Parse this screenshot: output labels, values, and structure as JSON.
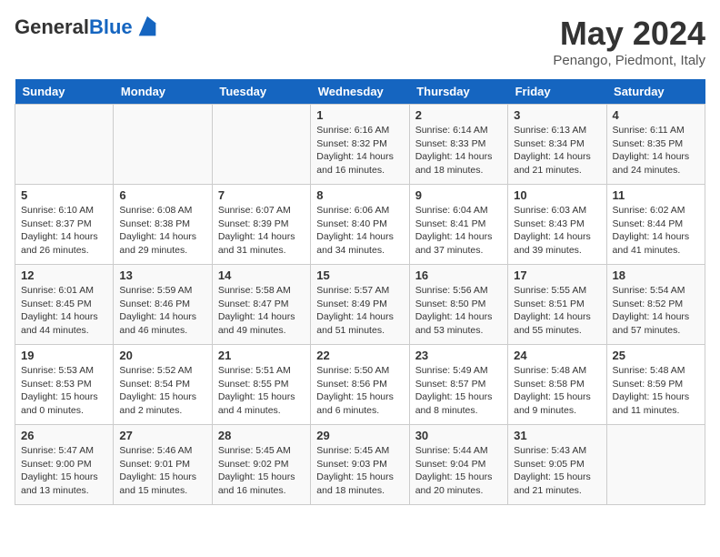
{
  "logo": {
    "general": "General",
    "blue": "Blue"
  },
  "title": "May 2024",
  "subtitle": "Penango, Piedmont, Italy",
  "days_of_week": [
    "Sunday",
    "Monday",
    "Tuesday",
    "Wednesday",
    "Thursday",
    "Friday",
    "Saturday"
  ],
  "weeks": [
    [
      {
        "day": "",
        "info": ""
      },
      {
        "day": "",
        "info": ""
      },
      {
        "day": "",
        "info": ""
      },
      {
        "day": "1",
        "info": "Sunrise: 6:16 AM\nSunset: 8:32 PM\nDaylight: 14 hours and 16 minutes."
      },
      {
        "day": "2",
        "info": "Sunrise: 6:14 AM\nSunset: 8:33 PM\nDaylight: 14 hours and 18 minutes."
      },
      {
        "day": "3",
        "info": "Sunrise: 6:13 AM\nSunset: 8:34 PM\nDaylight: 14 hours and 21 minutes."
      },
      {
        "day": "4",
        "info": "Sunrise: 6:11 AM\nSunset: 8:35 PM\nDaylight: 14 hours and 24 minutes."
      }
    ],
    [
      {
        "day": "5",
        "info": "Sunrise: 6:10 AM\nSunset: 8:37 PM\nDaylight: 14 hours and 26 minutes."
      },
      {
        "day": "6",
        "info": "Sunrise: 6:08 AM\nSunset: 8:38 PM\nDaylight: 14 hours and 29 minutes."
      },
      {
        "day": "7",
        "info": "Sunrise: 6:07 AM\nSunset: 8:39 PM\nDaylight: 14 hours and 31 minutes."
      },
      {
        "day": "8",
        "info": "Sunrise: 6:06 AM\nSunset: 8:40 PM\nDaylight: 14 hours and 34 minutes."
      },
      {
        "day": "9",
        "info": "Sunrise: 6:04 AM\nSunset: 8:41 PM\nDaylight: 14 hours and 37 minutes."
      },
      {
        "day": "10",
        "info": "Sunrise: 6:03 AM\nSunset: 8:43 PM\nDaylight: 14 hours and 39 minutes."
      },
      {
        "day": "11",
        "info": "Sunrise: 6:02 AM\nSunset: 8:44 PM\nDaylight: 14 hours and 41 minutes."
      }
    ],
    [
      {
        "day": "12",
        "info": "Sunrise: 6:01 AM\nSunset: 8:45 PM\nDaylight: 14 hours and 44 minutes."
      },
      {
        "day": "13",
        "info": "Sunrise: 5:59 AM\nSunset: 8:46 PM\nDaylight: 14 hours and 46 minutes."
      },
      {
        "day": "14",
        "info": "Sunrise: 5:58 AM\nSunset: 8:47 PM\nDaylight: 14 hours and 49 minutes."
      },
      {
        "day": "15",
        "info": "Sunrise: 5:57 AM\nSunset: 8:49 PM\nDaylight: 14 hours and 51 minutes."
      },
      {
        "day": "16",
        "info": "Sunrise: 5:56 AM\nSunset: 8:50 PM\nDaylight: 14 hours and 53 minutes."
      },
      {
        "day": "17",
        "info": "Sunrise: 5:55 AM\nSunset: 8:51 PM\nDaylight: 14 hours and 55 minutes."
      },
      {
        "day": "18",
        "info": "Sunrise: 5:54 AM\nSunset: 8:52 PM\nDaylight: 14 hours and 57 minutes."
      }
    ],
    [
      {
        "day": "19",
        "info": "Sunrise: 5:53 AM\nSunset: 8:53 PM\nDaylight: 15 hours and 0 minutes."
      },
      {
        "day": "20",
        "info": "Sunrise: 5:52 AM\nSunset: 8:54 PM\nDaylight: 15 hours and 2 minutes."
      },
      {
        "day": "21",
        "info": "Sunrise: 5:51 AM\nSunset: 8:55 PM\nDaylight: 15 hours and 4 minutes."
      },
      {
        "day": "22",
        "info": "Sunrise: 5:50 AM\nSunset: 8:56 PM\nDaylight: 15 hours and 6 minutes."
      },
      {
        "day": "23",
        "info": "Sunrise: 5:49 AM\nSunset: 8:57 PM\nDaylight: 15 hours and 8 minutes."
      },
      {
        "day": "24",
        "info": "Sunrise: 5:48 AM\nSunset: 8:58 PM\nDaylight: 15 hours and 9 minutes."
      },
      {
        "day": "25",
        "info": "Sunrise: 5:48 AM\nSunset: 8:59 PM\nDaylight: 15 hours and 11 minutes."
      }
    ],
    [
      {
        "day": "26",
        "info": "Sunrise: 5:47 AM\nSunset: 9:00 PM\nDaylight: 15 hours and 13 minutes."
      },
      {
        "day": "27",
        "info": "Sunrise: 5:46 AM\nSunset: 9:01 PM\nDaylight: 15 hours and 15 minutes."
      },
      {
        "day": "28",
        "info": "Sunrise: 5:45 AM\nSunset: 9:02 PM\nDaylight: 15 hours and 16 minutes."
      },
      {
        "day": "29",
        "info": "Sunrise: 5:45 AM\nSunset: 9:03 PM\nDaylight: 15 hours and 18 minutes."
      },
      {
        "day": "30",
        "info": "Sunrise: 5:44 AM\nSunset: 9:04 PM\nDaylight: 15 hours and 20 minutes."
      },
      {
        "day": "31",
        "info": "Sunrise: 5:43 AM\nSunset: 9:05 PM\nDaylight: 15 hours and 21 minutes."
      },
      {
        "day": "",
        "info": ""
      }
    ]
  ]
}
